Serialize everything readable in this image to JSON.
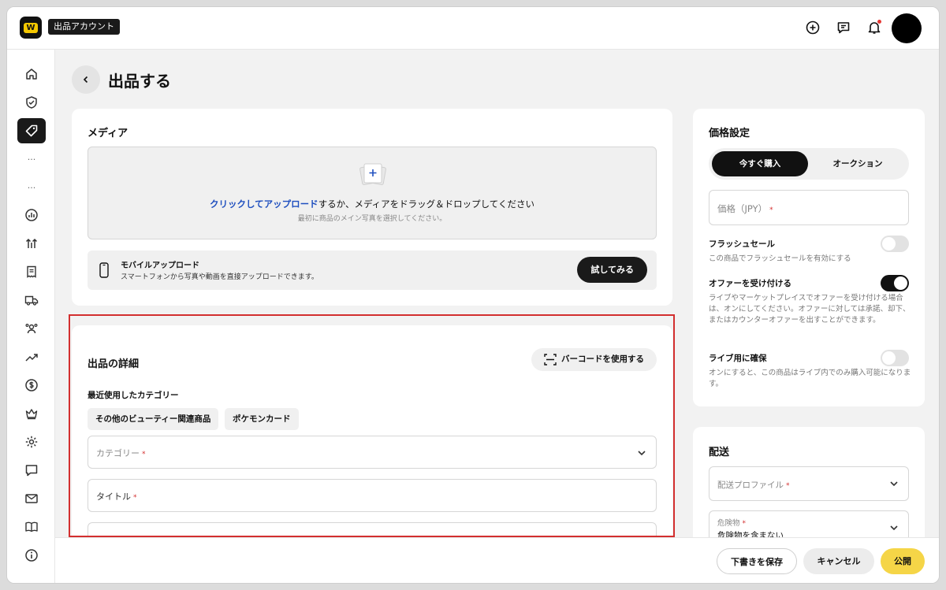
{
  "header": {
    "logo_letter": "W",
    "account_label": "出品アカウント"
  },
  "page": {
    "title": "出品する"
  },
  "media": {
    "title": "メディア",
    "upload_link": "クリックしてアップロード",
    "upload_rest": "するか、メディアをドラッグ＆ドロップしてください",
    "upload_sub": "最初に商品のメイン写真を選択してください。",
    "mobile_title": "モバイルアップロード",
    "mobile_sub": "スマートフォンから写真や動画を直接アップロードできます。",
    "try_button": "試してみる"
  },
  "details": {
    "title": "出品の詳細",
    "barcode_button": "バーコードを使用する",
    "recent_label": "最近使用したカテゴリー",
    "recent_categories": [
      "その他のビューティー関連商品",
      "ポケモンカード"
    ],
    "category_placeholder": "カテゴリー",
    "title_placeholder": "タイトル",
    "required_mark": "*"
  },
  "pricing": {
    "title": "価格設定",
    "tabs": [
      "今すぐ購入",
      "オークション"
    ],
    "price_placeholder": "価格（JPY）",
    "flash_title": "フラッシュセール",
    "flash_desc": "この商品でフラッシュセールを有効にする",
    "flash_on": false,
    "offer_title": "オファーを受け付ける",
    "offer_desc": "ライブやマーケットプレイスでオファーを受け付ける場合は、オンにしてください。オファーに対しては承諾、却下、またはカウンターオファーを出すことができます。",
    "offer_on": true,
    "live_title": "ライブ用に確保",
    "live_desc": "オンにすると、この商品はライブ内でのみ購入可能になります。",
    "live_on": false
  },
  "shipping": {
    "title": "配送",
    "profile_placeholder": "配送プロファイル",
    "hazmat_label": "危険物",
    "hazmat_value": "危険物を含まない"
  },
  "footer": {
    "save_draft": "下書きを保存",
    "cancel": "キャンセル",
    "publish": "公開"
  },
  "colors": {
    "brand_yellow": "#f5c800",
    "link_blue": "#1f4fbf",
    "highlight_red": "#d32f2f"
  }
}
